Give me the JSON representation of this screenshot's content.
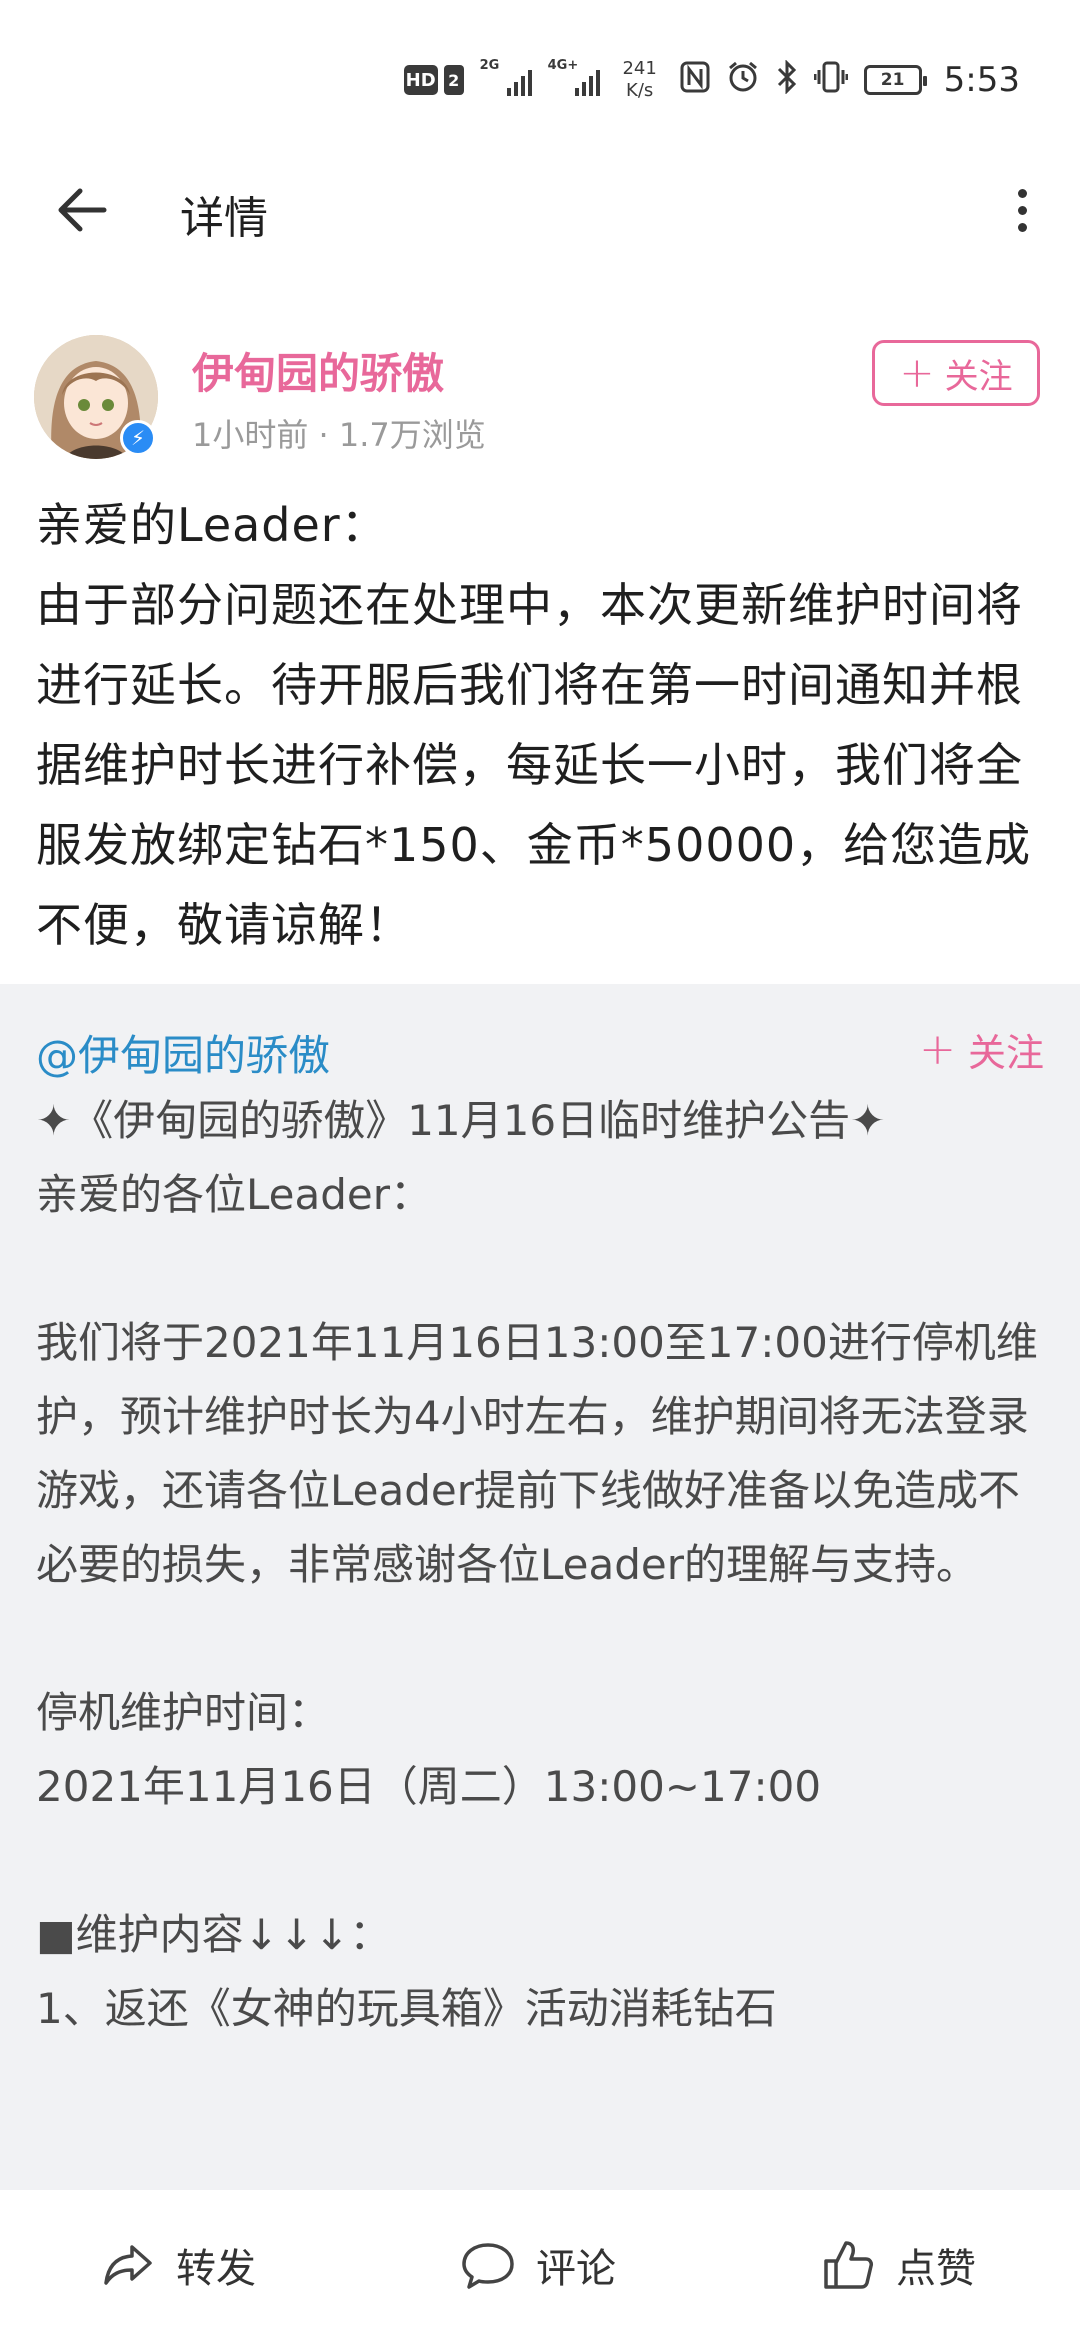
{
  "status_bar": {
    "hd": "HD",
    "sim": "2",
    "net1": "2G",
    "net2": "4G+",
    "speed_value": "241",
    "speed_unit": "K/s",
    "battery": "21",
    "time": "5:53",
    "icons": [
      "nfc-icon",
      "alarm-icon",
      "bluetooth-icon",
      "vibrate-icon",
      "battery-icon"
    ]
  },
  "app_bar": {
    "title": "详情"
  },
  "author": {
    "name": "伊甸园的骄傲",
    "meta": "1小时前 · 1.7万浏览",
    "follow_label": "关注"
  },
  "post": {
    "body": "亲爱的Leader：\n由于部分问题还在处理中，本次更新维护时间将进行延长。待开服后我们将在第一时间通知并根据维护时长进行补偿，每延长一小时，我们将全服发放绑定钻石*150、金币*50000，给您造成不便，敬请谅解！"
  },
  "shared": {
    "author": "@伊甸园的骄傲",
    "follow_label": "关注",
    "body": "✦《伊甸园的骄傲》11月16日临时维护公告✦\n亲爱的各位Leader：\n\n我们将于2021年11月16日13:00至17:00进行停机维护，预计维护时长为4小时左右，维护期间将无法登录游戏，还请各位Leader提前下线做好准备以免造成不必要的损失，非常感谢各位Leader的理解与支持。\n\n停机维护时间：\n2021年11月16日（周二）13:00~17:00\n\n■维护内容↓↓↓：\n1、返还《女神的玩具箱》活动消耗钻石"
  },
  "bottom_bar": {
    "repost_label": "转发",
    "comment_label": "评论",
    "like_label": "点赞"
  },
  "colors": {
    "accent_pink": "#e8689a",
    "link_blue": "#2a8cc7",
    "shared_bg": "#f1f2f4",
    "verified_blue": "#2a8cf5"
  }
}
